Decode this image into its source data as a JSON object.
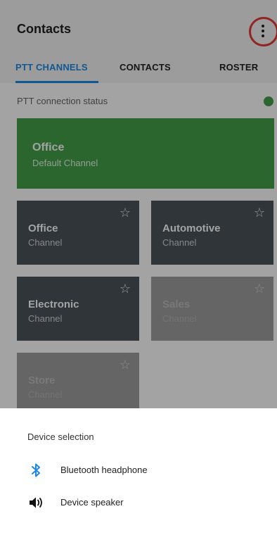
{
  "app_bar": {
    "title": "Contacts",
    "overflow_icon": "more-vert-icon",
    "highlight_color": "#e53935"
  },
  "tabs": [
    {
      "label": "PTT CHANNELS",
      "active": true
    },
    {
      "label": "CONTACTS",
      "active": false
    },
    {
      "label": "ROSTER",
      "active": false
    }
  ],
  "status": {
    "label": "PTT connection status",
    "state_color": "#43a047"
  },
  "default_channel": {
    "name": "Office",
    "subtitle": "Default Channel",
    "color": "#43a047"
  },
  "channels": [
    {
      "name": "Office",
      "type": "Channel",
      "style": "dark"
    },
    {
      "name": "Automotive",
      "type": "Channel",
      "style": "dark"
    },
    {
      "name": "Electronic",
      "type": "Channel",
      "style": "dark"
    },
    {
      "name": "Sales",
      "type": "Channel",
      "style": "light"
    },
    {
      "name": "Store",
      "type": "Channel",
      "style": "light"
    }
  ],
  "device_sheet": {
    "title": "Device selection",
    "options": [
      {
        "label": "Bluetooth headphone",
        "icon": "bluetooth-icon"
      },
      {
        "label": "Device speaker",
        "icon": "speaker-icon"
      }
    ]
  }
}
